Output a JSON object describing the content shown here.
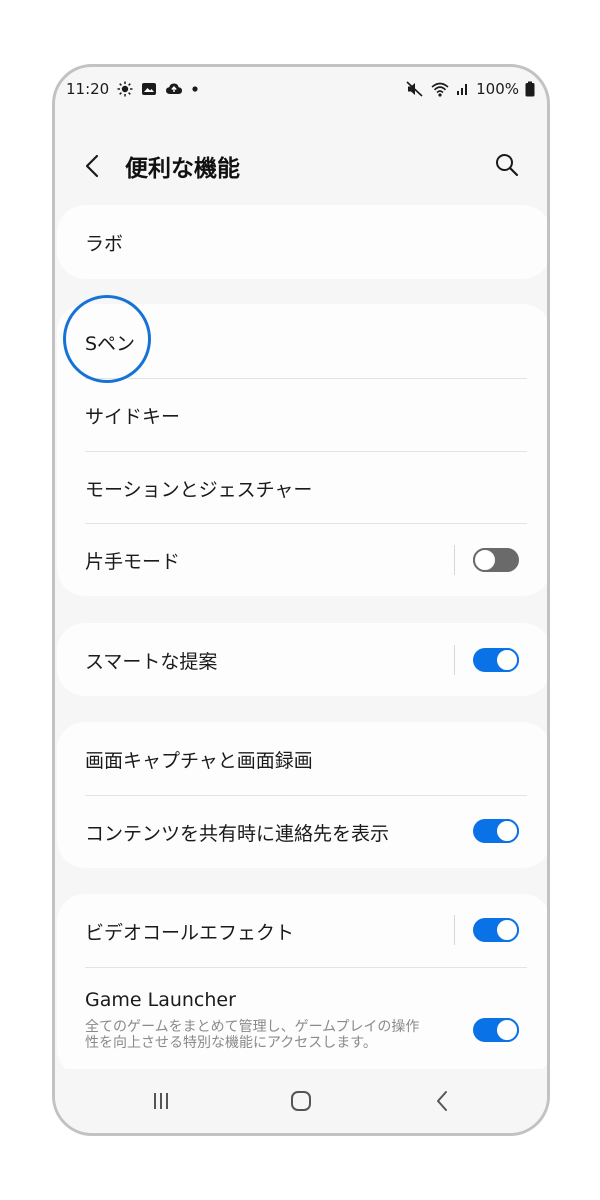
{
  "status_bar": {
    "time": "11:20",
    "battery": "100%",
    "icons": [
      "sun-icon",
      "gallery-icon",
      "cloud-icon",
      "dot-icon",
      "mute-icon",
      "wifi-icon",
      "signal-icon",
      "battery-icon"
    ]
  },
  "header": {
    "title": "便利な機能",
    "back_icon": "chevron-left-icon",
    "search_icon": "search-icon"
  },
  "groups": {
    "labs": {
      "label": "ラボ"
    },
    "s_pen": {
      "label": "Sペン"
    },
    "side_key": {
      "label": "サイドキー"
    },
    "motions": {
      "label": "モーションとジェスチャー"
    },
    "one_hand": {
      "label": "片手モード",
      "enabled": false
    },
    "smart_suggestions": {
      "label": "スマートな提案",
      "enabled": true
    },
    "screenshots": {
      "label": "画面キャプチャと画面録画"
    },
    "share_contacts": {
      "label": "コンテンツを共有時に連絡先を表示",
      "enabled": true
    },
    "video_call": {
      "label": "ビデオコールエフェクト",
      "enabled": true
    },
    "game_launcher": {
      "label": "Game Launcher",
      "description": "全てのゲームをまとめて管理し、ゲームプレイの操作性を向上させる特別な機能にアクセスします。",
      "enabled": true
    }
  },
  "colors": {
    "accent": "#0a72e7",
    "highlight": "#1673d6",
    "background": "#f6f6f6",
    "card": "#fdfdfd"
  },
  "navigation": {
    "recents_icon": "recents-icon",
    "home_icon": "home-icon",
    "back_icon": "back-icon"
  }
}
